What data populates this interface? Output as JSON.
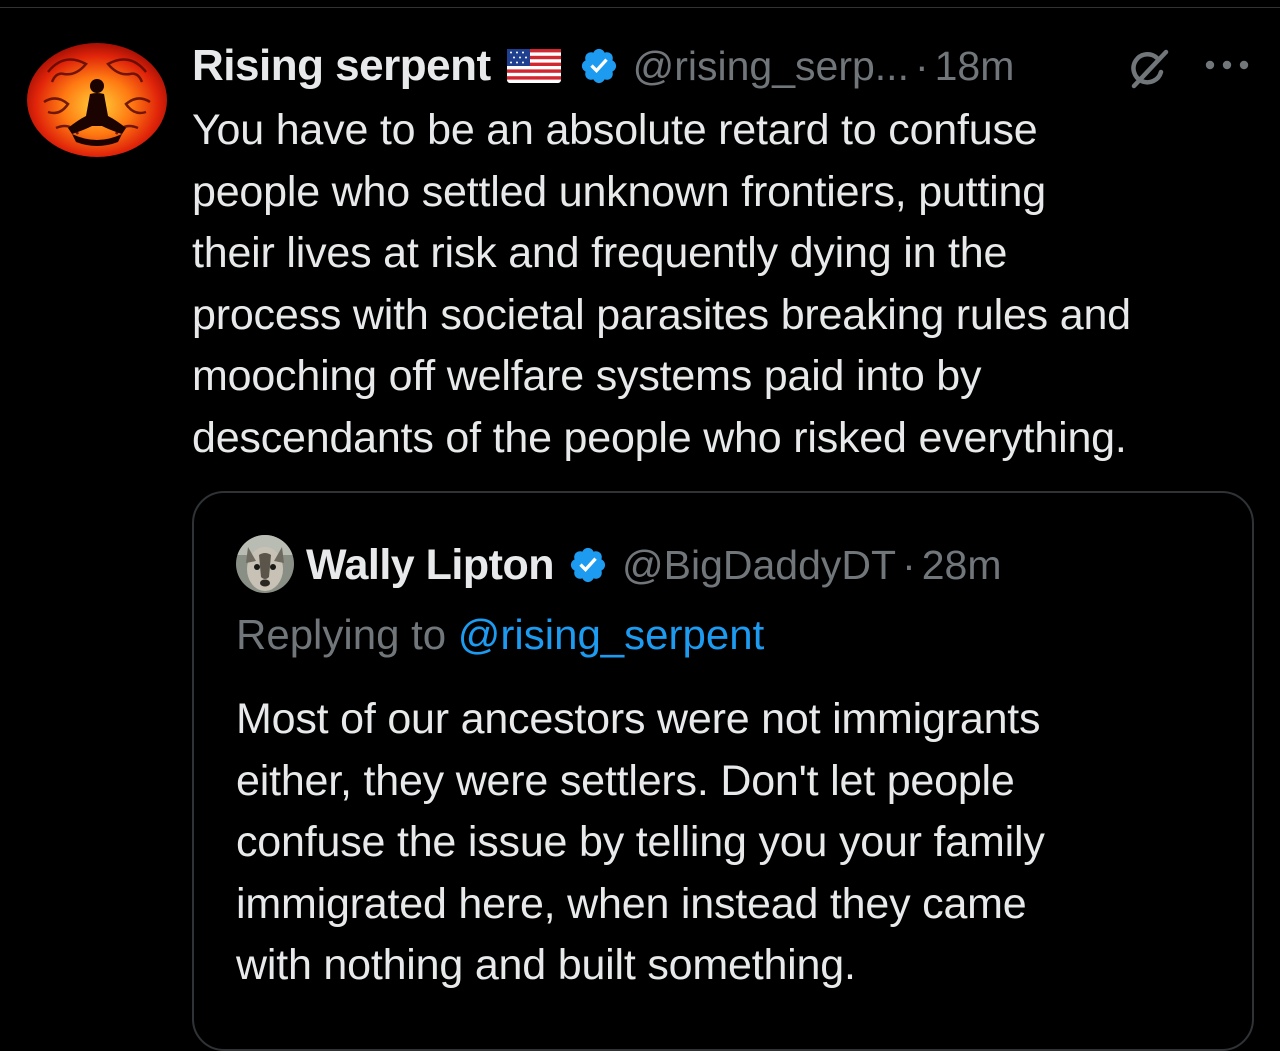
{
  "colors": {
    "background": "#000000",
    "text_primary": "#e7e9ea",
    "text_secondary": "#71767b",
    "accent_link": "#1d9bf0",
    "verified_badge": "#1d9bf0",
    "border": "#2f3336"
  },
  "tweet": {
    "display_name": "Rising serpent",
    "flag_icon": "us-flag-icon",
    "verified_icon": "verified-badge-icon",
    "handle": "@rising_serp...",
    "separator": "·",
    "time": "18m",
    "grok_icon": "grok-icon",
    "more_icon": "more-options-icon",
    "text": "You have to be an absolute retard to confuse\npeople who settled unknown frontiers, putting\ntheir lives at risk and frequently dying in the\nprocess with societal parasites breaking rules and\nmooching off welfare systems paid into by\ndescendants of the people who risked everything."
  },
  "quoted_tweet": {
    "display_name": "Wally Lipton",
    "verified_icon": "verified-badge-icon",
    "handle": "@BigDaddyDT",
    "separator": "·",
    "time": "28m",
    "replying_prefix": "Replying to ",
    "replying_mention": "@rising_serpent",
    "text": "Most of our ancestors were not immigrants\neither, they were settlers.  Don't let people\nconfuse the issue by telling you your family\nimmigrated here, when instead they came\nwith nothing and built something."
  }
}
